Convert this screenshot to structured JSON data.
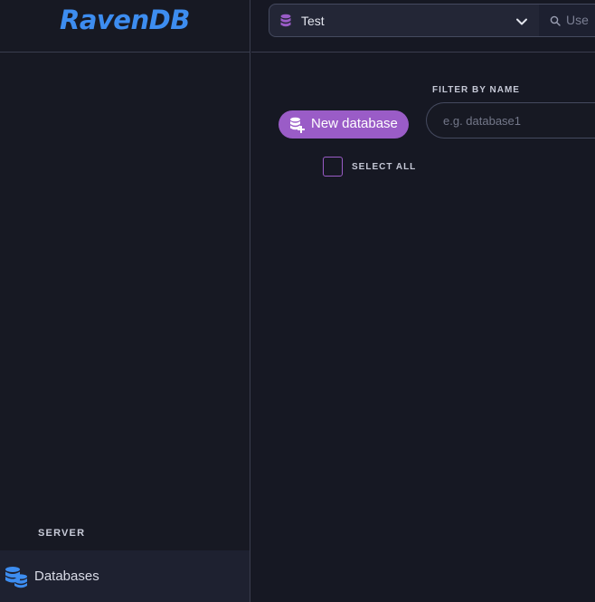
{
  "brand": {
    "logo_text": "RavenDB",
    "color": "#3d8df0"
  },
  "topbar": {
    "database_selector": {
      "selected": "Test",
      "icon": "database-icon"
    },
    "search": {
      "placeholder": "Use",
      "icon": "search-icon"
    }
  },
  "sidebar": {
    "section_title": "SERVER",
    "items": [
      {
        "label": "Databases",
        "icon": "databases-icon"
      }
    ]
  },
  "main": {
    "new_database_button": {
      "label": "New database",
      "icon": "database-plus-icon"
    },
    "filter": {
      "label": "FILTER BY NAME",
      "placeholder": "e.g. database1"
    },
    "select_all": {
      "label": "SELECT ALL",
      "checked": false
    }
  },
  "colors": {
    "accent": "#9a5cc7",
    "background": "#161823",
    "border": "#3a3d4e"
  }
}
